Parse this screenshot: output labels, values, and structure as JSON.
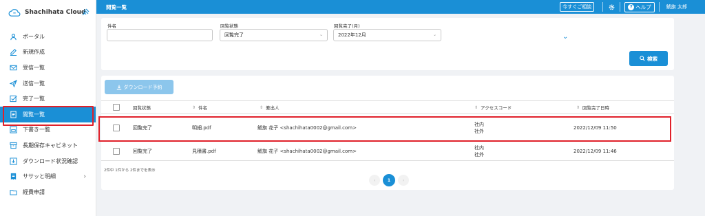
{
  "brand": {
    "name": "Shachihata Cloud"
  },
  "sidebar": {
    "items": [
      {
        "label": "ポータル",
        "icon": "user-icon"
      },
      {
        "label": "新規作成",
        "icon": "pen-icon"
      },
      {
        "label": "受信一覧",
        "icon": "mail-icon"
      },
      {
        "label": "送信一覧",
        "icon": "send-icon"
      },
      {
        "label": "完了一覧",
        "icon": "checkbox-icon"
      },
      {
        "label": "閲覧一覧",
        "icon": "document-icon",
        "active": true
      },
      {
        "label": "下書き一覧",
        "icon": "draft-icon"
      },
      {
        "label": "長期保存キャビネット",
        "icon": "cabinet-icon"
      },
      {
        "label": "ダウンロード状況確認",
        "icon": "download-box-icon"
      },
      {
        "label": "ササッと明細",
        "icon": "receipt-icon",
        "chevron": "›"
      },
      {
        "label": "経費申請",
        "icon": "folder-icon"
      }
    ]
  },
  "topbar": {
    "title": "閲覧一覧",
    "consult_label": "今すぐご相談",
    "help_label": "ヘルプ",
    "help_icon_char": "?",
    "user_name": "鯱旗 太郎"
  },
  "search": {
    "subject_label": "件名",
    "subject_value": "",
    "status_label": "回覧状態",
    "status_value": "回覧完了",
    "completed_label": "回覧完了(月)",
    "completed_value": "2022年12月",
    "dropdown_char": "⌄",
    "expand_char": "⌄",
    "search_button_label": "検索"
  },
  "results": {
    "download_button_label": "ダウンロード予約",
    "columns": {
      "status": "回覧状態",
      "subject": "件名",
      "sender": "差出人",
      "access_code": "アクセスコード",
      "completed_at": "回覧完了日時"
    },
    "sort_char": "⇕",
    "rows": [
      {
        "status": "回覧完了",
        "subject": "明細.pdf",
        "sender": "鯱旗 花子 <shachihata0002@gmail.com>",
        "access_inner": "社内",
        "access_outer": "社外",
        "completed_at": "2022/12/09 11:50"
      },
      {
        "status": "回覧完了",
        "subject": "見積書.pdf",
        "sender": "鯱旗 花子 <shachihata0002@gmail.com>",
        "access_inner": "社内",
        "access_outer": "社外",
        "completed_at": "2022/12/09 11:46"
      }
    ],
    "count_text": "2件中 1件から 2件までを表示",
    "pagination": {
      "prev": "‹",
      "current": "1",
      "next": "›"
    }
  },
  "colors": {
    "accent": "#1a8fd6",
    "highlight": "#e0202a"
  }
}
